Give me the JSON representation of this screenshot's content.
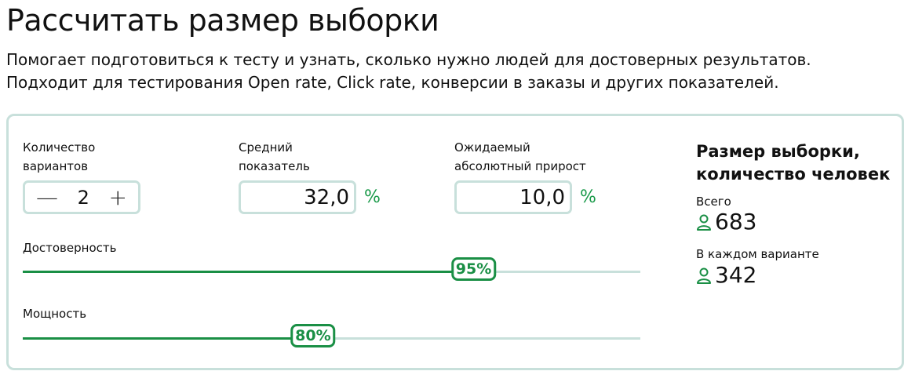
{
  "header": {
    "title": "Рассчитать размер выборки",
    "subtitle_line1": "Помогает подготовиться к тесту и узнать, сколько нужно людей для достоверных результатов.",
    "subtitle_line2": "Подходит для тестирования Open rate, Click rate, конверсии в заказы и других показателей."
  },
  "inputs": {
    "variants": {
      "label_line1": "Количество",
      "label_line2": "вариантов",
      "value": "2",
      "minus": "—",
      "plus": "+"
    },
    "average": {
      "label_line1": "Средний",
      "label_line2": "показатель",
      "value": "32,0",
      "unit": "%"
    },
    "growth": {
      "label_line1": "Ожидаемый",
      "label_line2": "абсолютный прирост",
      "value": "10,0",
      "unit": "%"
    }
  },
  "sliders": {
    "confidence": {
      "label": "Достоверность",
      "value_label": "95%",
      "fraction": 0.73
    },
    "power": {
      "label": "Мощность",
      "value_label": "80%",
      "fraction": 0.47
    }
  },
  "result": {
    "title_line1": "Размер выборки,",
    "title_line2": "количество человек",
    "total_label": "Всего",
    "total_value": "683",
    "per_variant_label": "В каждом варианте",
    "per_variant_value": "342",
    "icon": "person-icon"
  },
  "colors": {
    "accent": "#1a8f45",
    "border": "#c8e0db"
  }
}
